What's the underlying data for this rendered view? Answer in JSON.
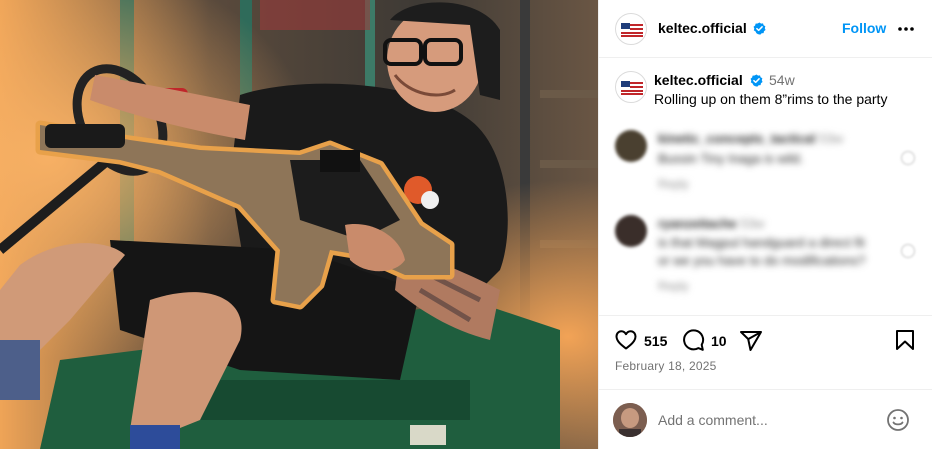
{
  "post": {
    "username": "keltec.official",
    "follow_label": "Follow",
    "caption": {
      "username": "keltec.official",
      "time_ago": "54w",
      "text": "Rolling up on them 8”rims to the party"
    },
    "comments": [
      {
        "username": "kinetic_concepts_tactical",
        "time_ago": "53w",
        "text": "Bussin Tiny Inaga is wild.",
        "reply_label": "Reply"
      },
      {
        "username": "ryanzeitache",
        "time_ago": "53w",
        "text_line1": "is that Magpul handguard a direct fit",
        "text_line2": "or we you have to do modifications?",
        "reply_label": "Reply"
      }
    ],
    "likes": "515",
    "comment_count": "10",
    "date": "February 18, 2025",
    "comment_placeholder": "Add a comment..."
  },
  "icons": {
    "verified": "verified-badge-icon",
    "more": "more-options-icon",
    "like": "heart-icon",
    "comment": "comment-icon",
    "share": "share-icon",
    "save": "bookmark-icon",
    "emoji": "emoji-icon"
  },
  "colors": {
    "accent_blue": "#0095f6",
    "verified_blue": "#0095f6",
    "muted_text": "#737373",
    "photo_orange": "#e8a14a"
  }
}
